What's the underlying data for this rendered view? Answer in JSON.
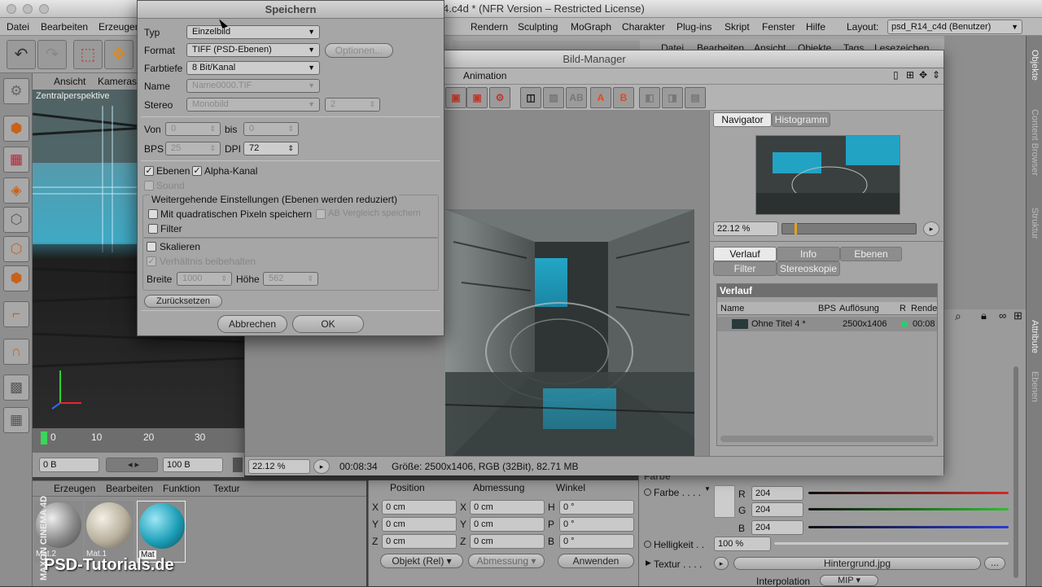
{
  "app": {
    "window_title": "psd_R14.c4d * (NFR Version – Restricted License)",
    "title_visible": "4.c4d * (NFR Version – Restricted License)",
    "layout_label": "Layout:",
    "layout_value": "psd_R14_c4d (Benutzer)"
  },
  "menubar": [
    "Datei",
    "Bearbeiten",
    "Erzeugen",
    "Rendern",
    "Sculpting",
    "MoGraph",
    "Charakter",
    "Plug-ins",
    "Skript",
    "Fenster",
    "Hilfe"
  ],
  "object_manager_menu": [
    "Datei",
    "Bearbeiten",
    "Ansicht",
    "Objekte",
    "Tags",
    "Lesezeichen"
  ],
  "viewport": {
    "menu": [
      "Ansicht",
      "Kameras"
    ],
    "label": "Zentralperspektive"
  },
  "timeline": {
    "ticks": [
      "0",
      "10",
      "20",
      "30"
    ],
    "current": "0 B",
    "start": "0 B",
    "end": "100 B"
  },
  "materials": {
    "menu": [
      "Erzeugen",
      "Bearbeiten",
      "Funktion",
      "Textur"
    ],
    "items": [
      "Mat.2",
      "Mat.1",
      "Mat"
    ],
    "watermark": "PSD-Tutorials.de",
    "brand": "MAXON CINEMA 4D"
  },
  "coords": {
    "headers": [
      "Position",
      "Abmessung",
      "Winkel"
    ],
    "rows": [
      {
        "a": "X",
        "pos": "0 cm",
        "b": "X",
        "size": "0 cm",
        "c": "H",
        "ang": "0 °"
      },
      {
        "a": "Y",
        "pos": "0 cm",
        "b": "Y",
        "size": "0 cm",
        "c": "P",
        "ang": "0 °"
      },
      {
        "a": "Z",
        "pos": "0 cm",
        "b": "Z",
        "size": "0 cm",
        "c": "B",
        "ang": "0 °"
      }
    ],
    "mode1": "Objekt (Rel)",
    "mode2": "Abmessung",
    "apply": "Anwenden"
  },
  "attributes": {
    "section": "Farbe",
    "farbe_label": "Farbe . . . .",
    "r_label": "R",
    "r": "204",
    "g_label": "G",
    "g": "204",
    "b_label": "B",
    "b": "204",
    "helligkeit_label": "Helligkeit . .",
    "helligkeit": "100 %",
    "textur_label": "Textur . . . .",
    "textur_value": "Hintergrund.jpg",
    "interpolation_label": "Interpolation",
    "interpolation_value": "MIP",
    "colors": {
      "r": "#d32a2a",
      "g": "#2fbf2f",
      "b": "#2a3ad3"
    }
  },
  "side_tabs": [
    "Objekte",
    "Content Browser",
    "Struktur",
    "Attribute",
    "Ebenen"
  ],
  "bild_manager": {
    "title": "Bild-Manager",
    "menu_item": "Animation",
    "navigator_tabs": [
      "Navigator",
      "Histogramm"
    ],
    "zoom": "22.12 %",
    "history_tabs": [
      "Verlauf",
      "Info",
      "Ebenen",
      "Filter",
      "Stereoskopie"
    ],
    "verlauf_title": "Verlauf",
    "columns": [
      "Name",
      "BPS",
      "Auflösung",
      "R",
      "Rende"
    ],
    "rows": [
      {
        "name": "Ohne Titel 4 *",
        "resolution": "2500x1406",
        "time": "00:08"
      }
    ],
    "status_zoom": "22.12 %",
    "status_time": "00:08:34",
    "status_info": "Größe: 2500x1406, RGB (32Bit), 82.71 MB"
  },
  "save_dialog": {
    "title": "Speichern",
    "typ_label": "Typ",
    "typ_value": "Einzelbild",
    "format_label": "Format",
    "format_value": "TIFF (PSD-Ebenen)",
    "options_button": "Optionen...",
    "farbtiefe_label": "Farbtiefe",
    "farbtiefe_value": "8 Bit/Kanal",
    "name_label": "Name",
    "name_value": "Name0000.TIF",
    "stereo_label": "Stereo",
    "stereo_value": "Monobild",
    "stereo_num": "2",
    "von_label": "Von",
    "von_value": "0",
    "bis_label": "bis",
    "bis_value": "0",
    "bps_label": "BPS",
    "bps_value": "25",
    "dpi_label": "DPI",
    "dpi_value": "72",
    "ebenen_label": "Ebenen",
    "alpha_label": "Alpha-Kanal",
    "sound_label": "Sound",
    "group_title": "Weitergehende Einstellungen (Ebenen werden reduziert)",
    "quad_label": "Mit quadratischen Pixeln speichern",
    "ab_label": "AB Vergleich speichern",
    "filter_label": "Filter",
    "skalieren_label": "Skalieren",
    "verhaeltnis_label": "Verhältnis beibehalten",
    "breite_label": "Breite",
    "breite_value": "1000",
    "hoehe_label": "Höhe",
    "hoehe_value": "562",
    "reset_button": "Zurücksetzen",
    "cancel_button": "Abbrechen",
    "ok_button": "OK"
  }
}
